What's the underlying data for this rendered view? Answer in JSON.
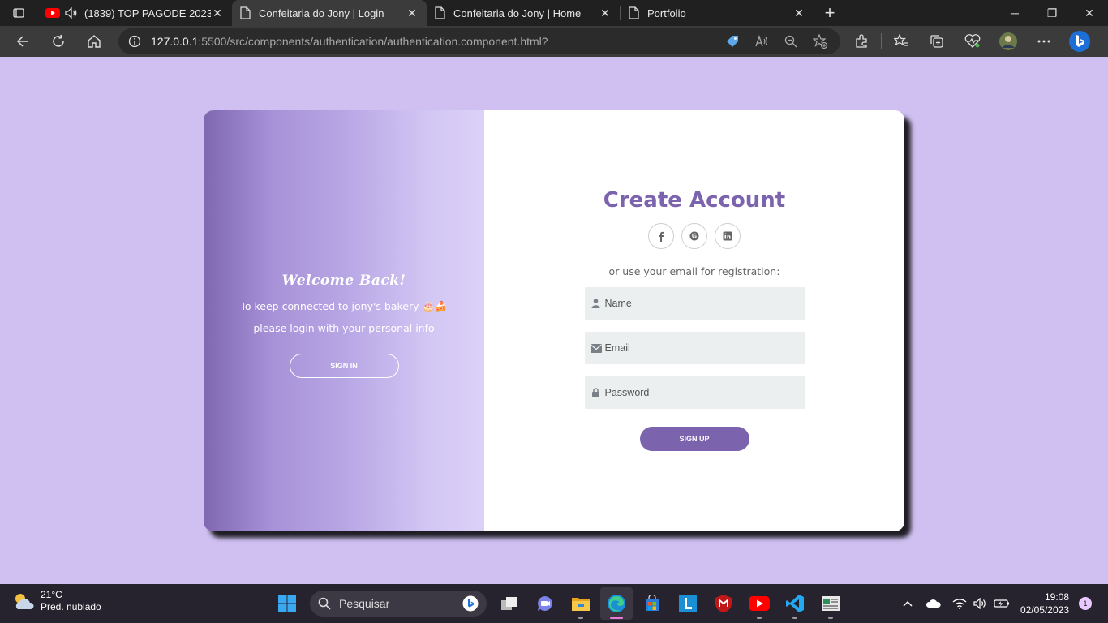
{
  "browser": {
    "tabs": [
      {
        "title": "(1839) TOP PAGODE 2023",
        "icon": "youtube-icon",
        "audio": true,
        "active": false
      },
      {
        "title": "Confeitaria do Jony | Login",
        "icon": "page-icon",
        "active": true
      },
      {
        "title": "Confeitaria do Jony | Home",
        "icon": "page-icon",
        "active": false
      },
      {
        "title": "Portfolio",
        "icon": "page-icon",
        "active": false
      }
    ],
    "url_host": "127.0.0.1",
    "url_rest": ":5500/src/components/authentication/authentication.component.html?",
    "accent": "#7b63ae"
  },
  "auth": {
    "welcome_title": "Welcome Back!",
    "welcome_line1": "To keep connected to jony's bakery 🎂🍰",
    "welcome_line2": "please login with your personal info",
    "signin_label": "SIGN IN",
    "create_title": "Create Account",
    "socials": [
      "facebook-icon",
      "google-icon",
      "linkedin-icon"
    ],
    "helper_text": "or use your email for registration:",
    "name_placeholder": "Name",
    "email_placeholder": "Email",
    "password_placeholder": "Password",
    "signup_label": "SIGN UP"
  },
  "taskbar": {
    "temperature": "21°C",
    "weather": "Pred. nublado",
    "search_placeholder": "Pesquisar",
    "time": "19:08",
    "date": "02/05/2023",
    "notifications": "1"
  }
}
